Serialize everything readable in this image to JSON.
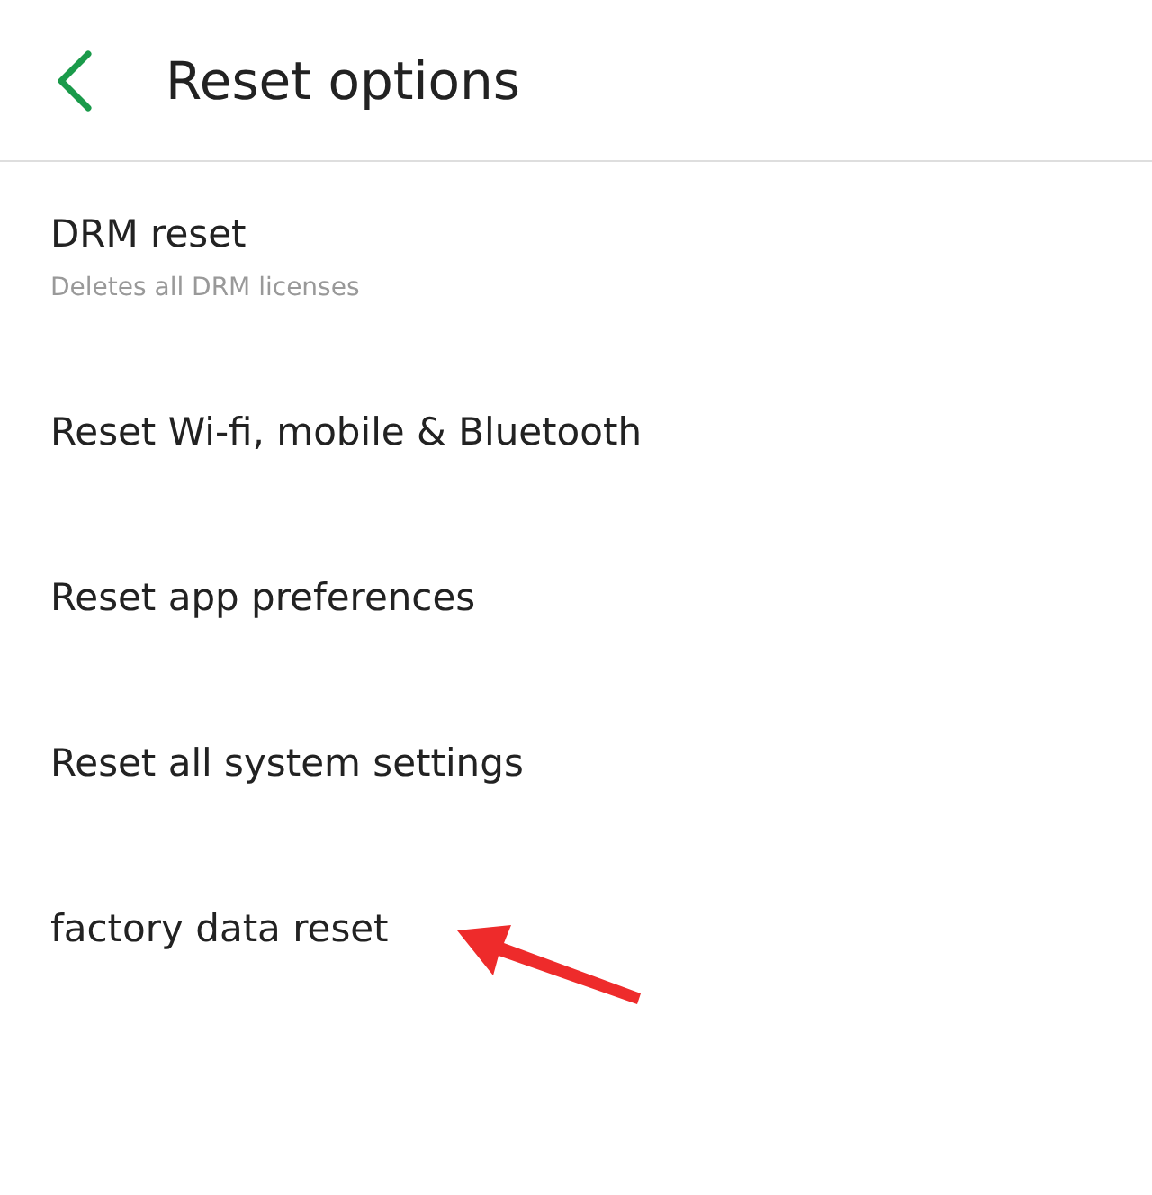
{
  "header": {
    "title": "Reset options"
  },
  "items": [
    {
      "title": "DRM reset",
      "subtitle": "Deletes all DRM licenses"
    },
    {
      "title": "Reset Wi-fi, mobile & Bluetooth"
    },
    {
      "title": "Reset app preferences"
    },
    {
      "title": "Reset all system settings"
    },
    {
      "title": "factory data reset"
    }
  ]
}
